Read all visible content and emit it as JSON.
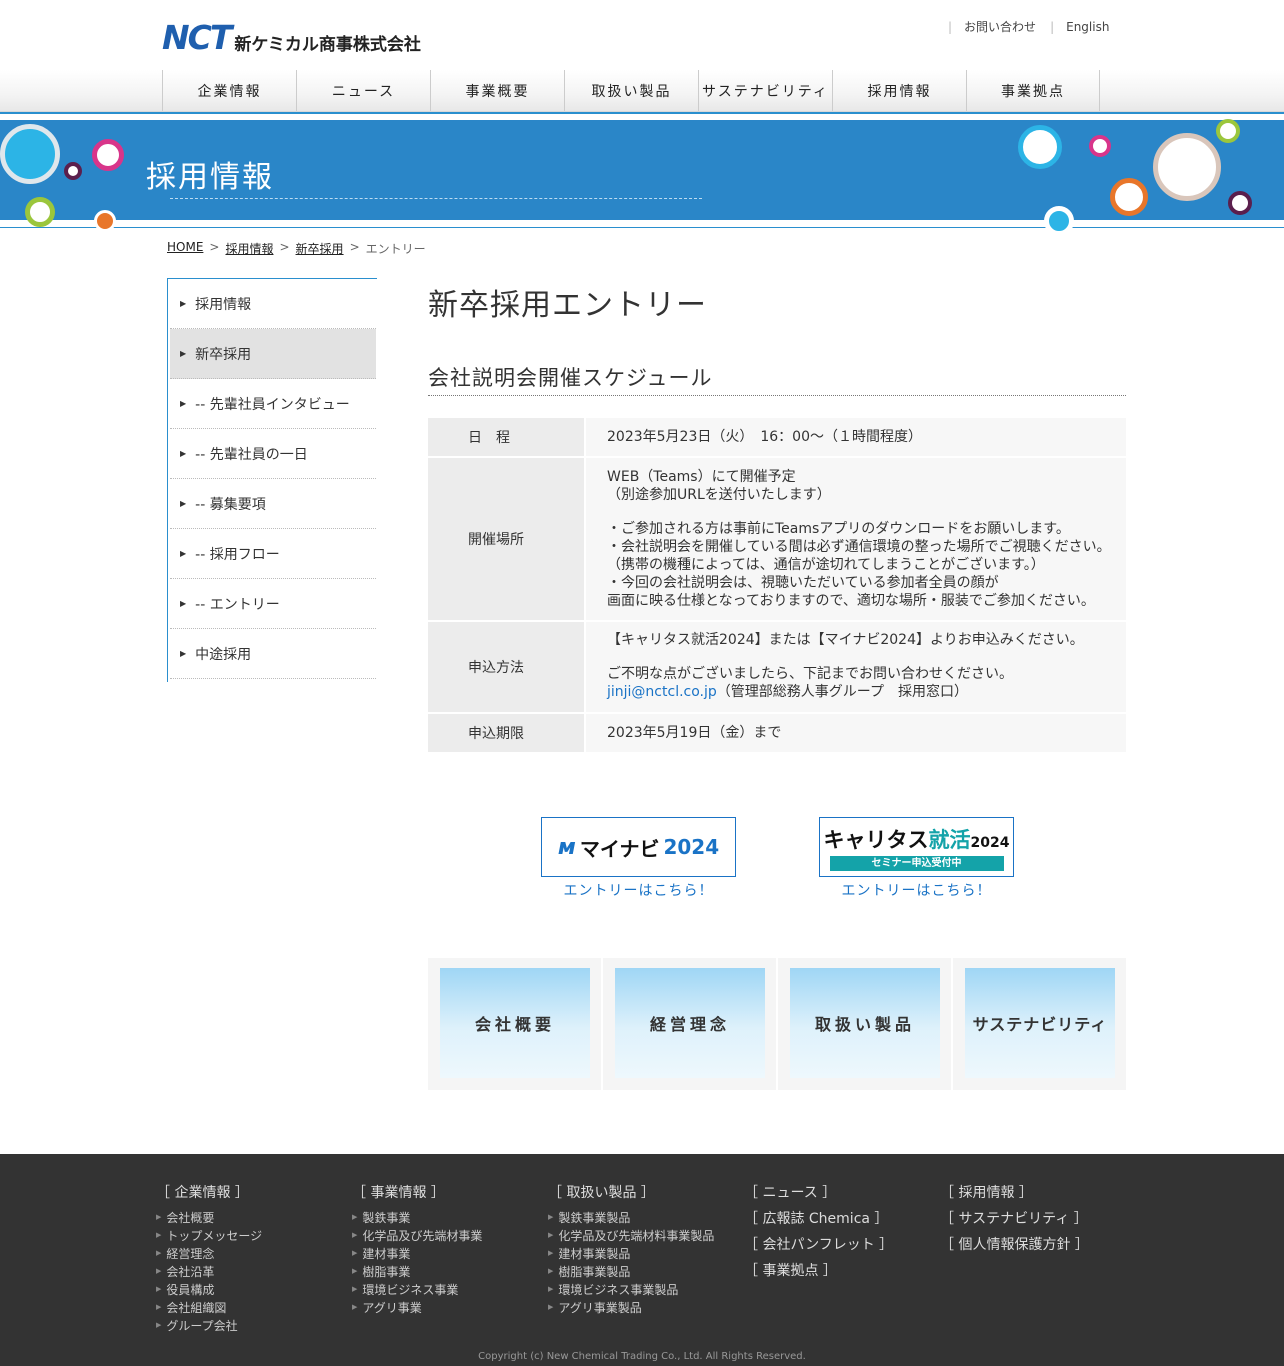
{
  "header": {
    "logo_mark": "NCT",
    "logo_name": "新ケミカル商事株式会社",
    "contact_link": "お問い合わせ",
    "english_link": "English"
  },
  "nav": [
    "企業情報",
    "ニュース",
    "事業概要",
    "取扱い製品",
    "サステナビリティ",
    "採用情報",
    "事業拠点"
  ],
  "banner": {
    "title": "採用情報"
  },
  "breadcrumb": {
    "home": "HOME",
    "recruit": "採用情報",
    "newgrad": "新卒採用",
    "current": "エントリー",
    "sep": ">"
  },
  "sidebar": {
    "items": [
      "採用情報",
      "新卒採用",
      "-- 先輩社員インタビュー",
      "-- 先輩社員の一日",
      "-- 募集要項",
      "-- 採用フロー",
      "-- エントリー",
      "中途採用"
    ],
    "arrow": "▶"
  },
  "main": {
    "title": "新卒採用エントリー",
    "subtitle": "会社説明会開催スケジュール",
    "schedule": {
      "date_label": "日　程",
      "date_value": "2023年5月23日（火）　16：00～（１時間程度）",
      "place_label": "開催場所",
      "place_lines": [
        "WEB（Teams）にて開催予定",
        "（別途参加URLを送付いたします）",
        "",
        "・ご参加される方は事前にTeamsアプリのダウンロードをお願いします。",
        "・会社説明会を開催している間は必ず通信環境の整った場所でご視聴ください。",
        "（携帯の機種によっては、通信が途切れてしまうことがございます。）",
        "・今回の会社説明会は、視聴いただいている参加者全員の顔が",
        "画面に映る仕様となっておりますので、適切な場所・服装でご参加ください。"
      ],
      "apply_label": "申込方法",
      "apply_line1": "【キャリタス就活2024】または【マイナビ2024】よりお申込みください。",
      "apply_line2": "ご不明な点がございましたら、下記までお問い合わせください。",
      "apply_email": "jinji@nctcl.co.jp",
      "apply_email_note": "（管理部総務人事グループ　採用窓口）",
      "deadline_label": "申込期限",
      "deadline_value": "2023年5月19日（金）まで"
    }
  },
  "entry_banners": {
    "mynavi": {
      "mark": "м",
      "name": "マイナビ",
      "year": "2024",
      "caption": "エントリーはこちら！"
    },
    "careertasu": {
      "name": "キャリタス",
      "kj": "就活",
      "year": "2024",
      "bar": "セミナー申込受付中",
      "caption": "エントリーはこちら！"
    }
  },
  "tiles": [
    "会社概要",
    "経営理念",
    "取扱い製品",
    "サステナビリティ"
  ],
  "footer": {
    "col1": {
      "head": "［ 企業情報 ］",
      "items": [
        "会社概要",
        "トップメッセージ",
        "経営理念",
        "会社沿革",
        "役員構成",
        "会社組織図",
        "グループ会社"
      ]
    },
    "col2": {
      "head": "［ 事業情報 ］",
      "items": [
        "製鉄事業",
        "化学品及び先端材事業",
        "建材事業",
        "樹脂事業",
        "環境ビジネス事業",
        "アグリ事業"
      ]
    },
    "col3": {
      "head": "［ 取扱い製品 ］",
      "items": [
        "製鉄事業製品",
        "化学品及び先端材料事業製品",
        "建材事業製品",
        "樹脂事業製品",
        "環境ビジネス事業製品",
        "アグリ事業製品"
      ]
    },
    "col4": [
      "［ ニュース ］",
      "［ 広報誌 Chemica ］",
      "［ 会社パンフレット ］",
      "［ 事業拠点 ］"
    ],
    "col5": [
      "［ 採用情報 ］",
      "［ サステナビリティ ］",
      "［ 個人情報保護方針 ］"
    ],
    "arrow": "▶",
    "copyright": "Copyright (c) New Chemical Trading Co., Ltd. All Rights Reserved."
  }
}
